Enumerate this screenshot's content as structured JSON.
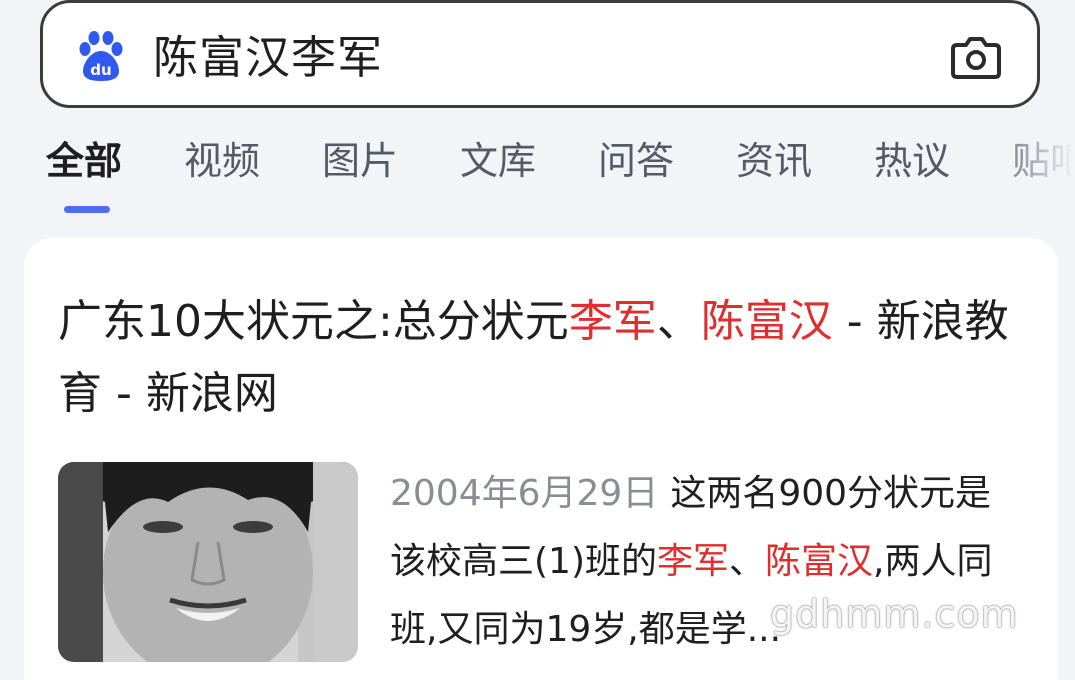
{
  "search": {
    "query": "陈富汉李军"
  },
  "tabs": [
    {
      "label": "全部"
    },
    {
      "label": "视频"
    },
    {
      "label": "图片"
    },
    {
      "label": "文库"
    },
    {
      "label": "问答"
    },
    {
      "label": "资讯"
    },
    {
      "label": "热议"
    },
    {
      "label": "贴吧"
    }
  ],
  "active_tab": "全部",
  "result": {
    "title_part1": "广东10大状元之:总分状元",
    "title_hl1": "李军",
    "title_sep": "、",
    "title_hl2": "陈富汉",
    "title_part2": " - 新浪教育 - 新浪网",
    "date": "2004年6月29日",
    "snippet_part1": "这两名900分状元是该校高三(1)班的",
    "snippet_hl1": "李军",
    "snippet_sep": "、",
    "snippet_hl2": "陈富汉",
    "snippet_part2": ",两人同班,又同为19岁,都是学..."
  },
  "watermark": "gdhmm.com",
  "colors": {
    "accent": "#4e6ef2",
    "highlight": "#e02d2d",
    "page_bg": "#f3f4f8"
  },
  "icons": {
    "logo": "baidu-paw-icon",
    "camera": "camera-icon"
  }
}
